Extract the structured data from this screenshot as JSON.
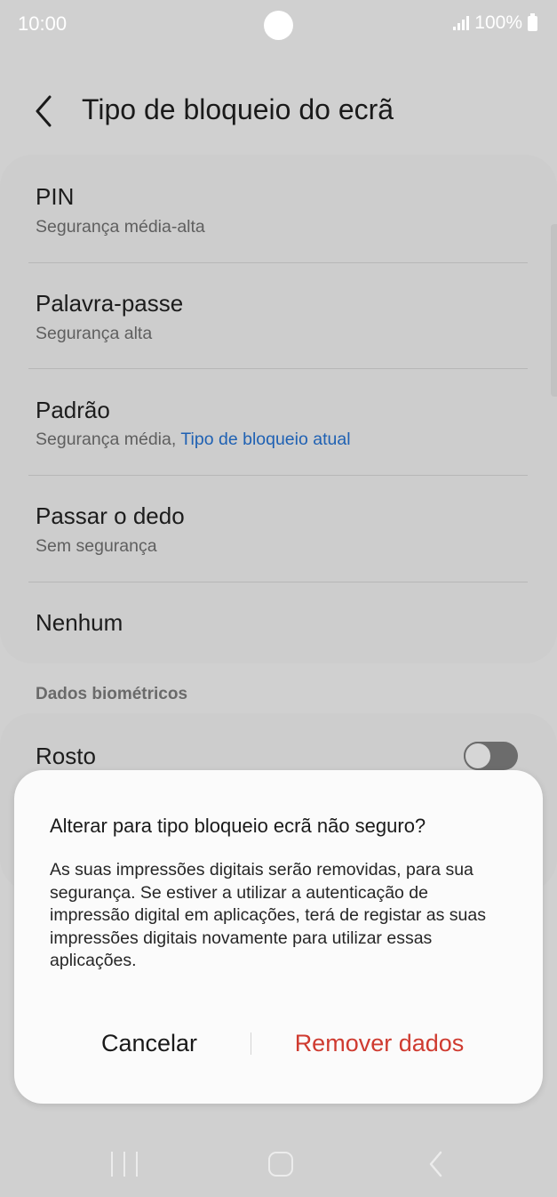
{
  "status_bar": {
    "time": "10:00",
    "battery": "100%",
    "icons": [
      "camera-hole",
      "signal-icon",
      "battery-icon"
    ]
  },
  "header": {
    "back_icon": "chevron-left-icon",
    "title": "Tipo de bloqueio do ecrã"
  },
  "lock_types": [
    {
      "title": "PIN",
      "subtitle": "Segurança média-alta"
    },
    {
      "title": "Palavra-passe",
      "subtitle": "Segurança alta"
    },
    {
      "title": "Padrão",
      "subtitle": "Segurança média,",
      "subtitle_link": "Tipo de bloqueio atual"
    },
    {
      "title": "Passar o dedo",
      "subtitle": "Sem segurança"
    },
    {
      "title": "Nenhum"
    }
  ],
  "biometrics": {
    "section_label": "Dados biométricos",
    "face_label": "Rosto",
    "face_enabled": false
  },
  "dialog": {
    "title": "Alterar para tipo bloqueio ecrã não seguro?",
    "body": "As suas impressões digitais serão removidas, para sua segurança. Se estiver a utilizar a autenticação de impressão digital em aplicações, terá de registar as suas impressões digitais novamente para utilizar essas aplicações.",
    "cancel_label": "Cancelar",
    "remove_label": "Remover dados"
  },
  "nav_bar": {
    "icons": [
      "recent-apps-icon",
      "home-icon",
      "back-icon"
    ]
  },
  "colors": {
    "link": "#1f61b3",
    "destructive": "#cf3b30",
    "dimmed_background": "#d0d0d0",
    "dialog_background": "#fbfbfb"
  }
}
